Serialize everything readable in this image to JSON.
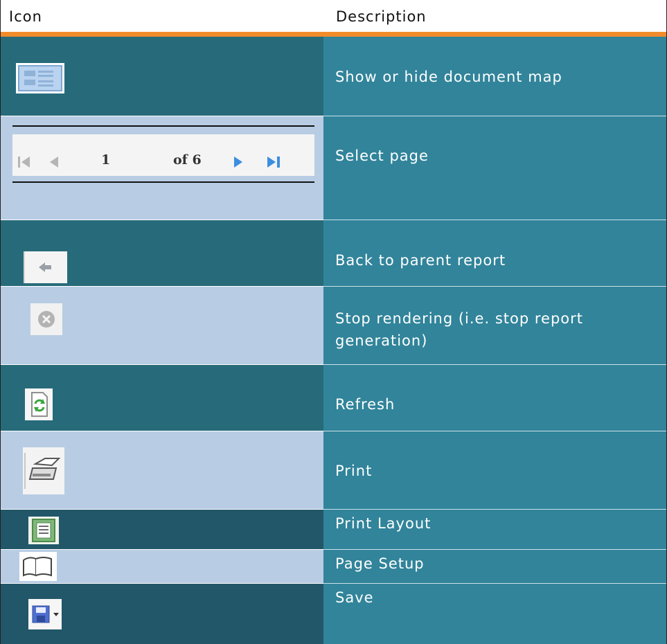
{
  "header": {
    "col_icon": "Icon",
    "col_description": "Description"
  },
  "pager": {
    "page_number": "1",
    "of_label": "of 6"
  },
  "rows": [
    {
      "icon": "document-map-icon",
      "description": "Show or hide document map"
    },
    {
      "icon": "page-navigation-icon",
      "description": "Select page"
    },
    {
      "icon": "back-arrow-icon",
      "description": "Back to parent report"
    },
    {
      "icon": "stop-icon",
      "description": "Stop rendering (i.e. stop report generation)"
    },
    {
      "icon": "refresh-icon",
      "description": "Refresh"
    },
    {
      "icon": "printer-icon",
      "description": "Print"
    },
    {
      "icon": "print-layout-icon",
      "description": "Print Layout"
    },
    {
      "icon": "page-setup-icon",
      "description": "Page Setup"
    },
    {
      "icon": "save-icon",
      "description": "Save"
    }
  ],
  "colors": {
    "accent_line": "#f28c2b",
    "desc_cell": "#31849a",
    "dark_cell": "#276b7a",
    "light_cell": "#b8cce4"
  }
}
